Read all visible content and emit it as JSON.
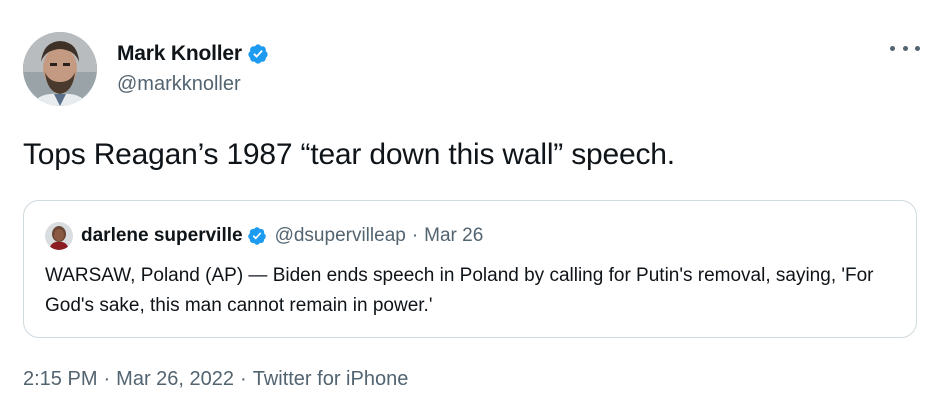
{
  "author": {
    "name": "Mark Knoller",
    "handle": "@markknoller",
    "verified": true
  },
  "tweet": {
    "text": "Tops Reagan’s 1987 “tear down this wall” speech."
  },
  "quoted_tweet": {
    "name": "darlene superville",
    "handle": "@dsupervilleap",
    "separator": "·",
    "date": "Mar 26",
    "text": "WARSAW, Poland (AP) — Biden ends speech in Poland by calling for Putin's removal, saying, 'For God's sake, this man cannot remain in power.'",
    "verified": true
  },
  "meta": {
    "time": "2:15 PM",
    "separator": "·",
    "date": "Mar 26, 2022",
    "source": "Twitter for iPhone"
  },
  "colors": {
    "verified_blue": "#1d9bf0",
    "secondary_text": "#536471",
    "primary_text": "#0f1419",
    "border": "#cfd9de"
  },
  "icons": {
    "verified": "verified-badge-icon",
    "more": "more-options-icon"
  }
}
